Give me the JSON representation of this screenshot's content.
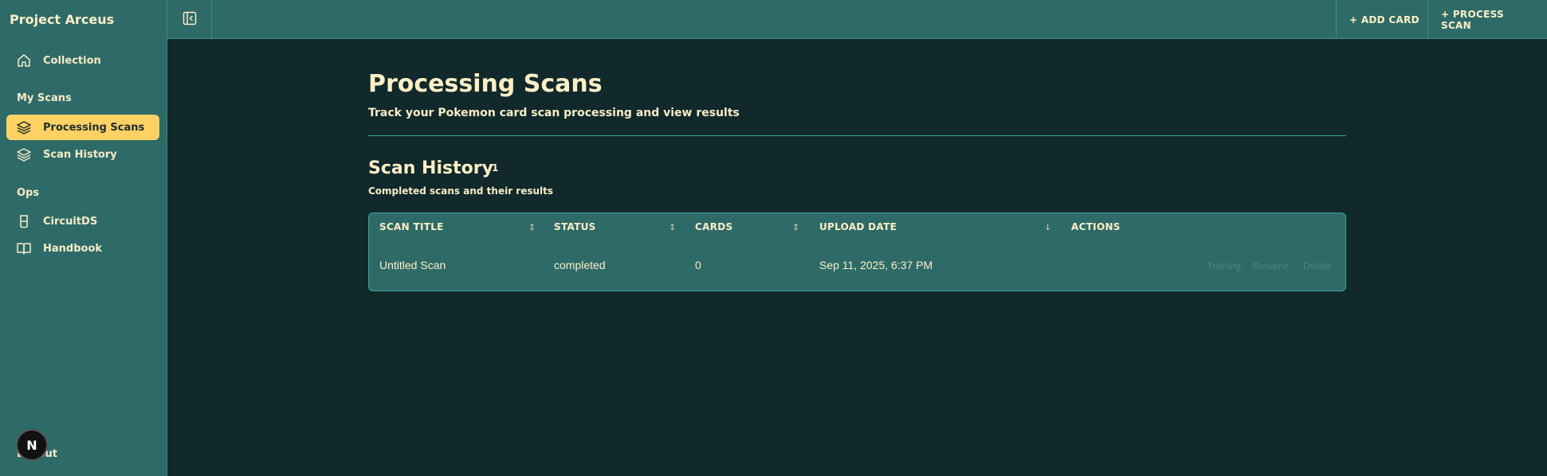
{
  "sidebar": {
    "brand": "Project Arceus",
    "items": [
      {
        "label": "Collection",
        "icon": "home-icon"
      },
      {
        "label": "Processing Scans",
        "icon": "layers-icon"
      },
      {
        "label": "Scan History",
        "icon": "layers-icon"
      },
      {
        "label": "CircuitDS",
        "icon": "beaker-icon"
      },
      {
        "label": "Handbook",
        "icon": "book-open-icon"
      }
    ],
    "sections": [
      "My Scans",
      "Ops"
    ],
    "logout": "Logout",
    "badge": "N"
  },
  "topbar": {
    "add_card": "+ ADD CARD",
    "process_scan": "+ PROCESS SCAN"
  },
  "main": {
    "title": "Processing Scans",
    "subtitle": "Track your Pokemon card scan processing and view results",
    "section_title": "Scan History",
    "section_count": "1",
    "section_subtitle": "Completed scans and their results",
    "table": {
      "headers": [
        "SCAN TITLE",
        "STATUS",
        "CARDS",
        "UPLOAD DATE",
        "ACTIONS"
      ],
      "rows": [
        {
          "title": "Untitled Scan",
          "status": "completed",
          "cards": "0",
          "upload_date": "Sep 11, 2025, 6:37 PM",
          "actions": [
            "Training",
            "Rename",
            "Delete"
          ]
        }
      ]
    }
  },
  "colors": {
    "background": "#12292b",
    "panel": "#2e6b68",
    "accent": "#fdd163",
    "text": "#fbefc6"
  }
}
